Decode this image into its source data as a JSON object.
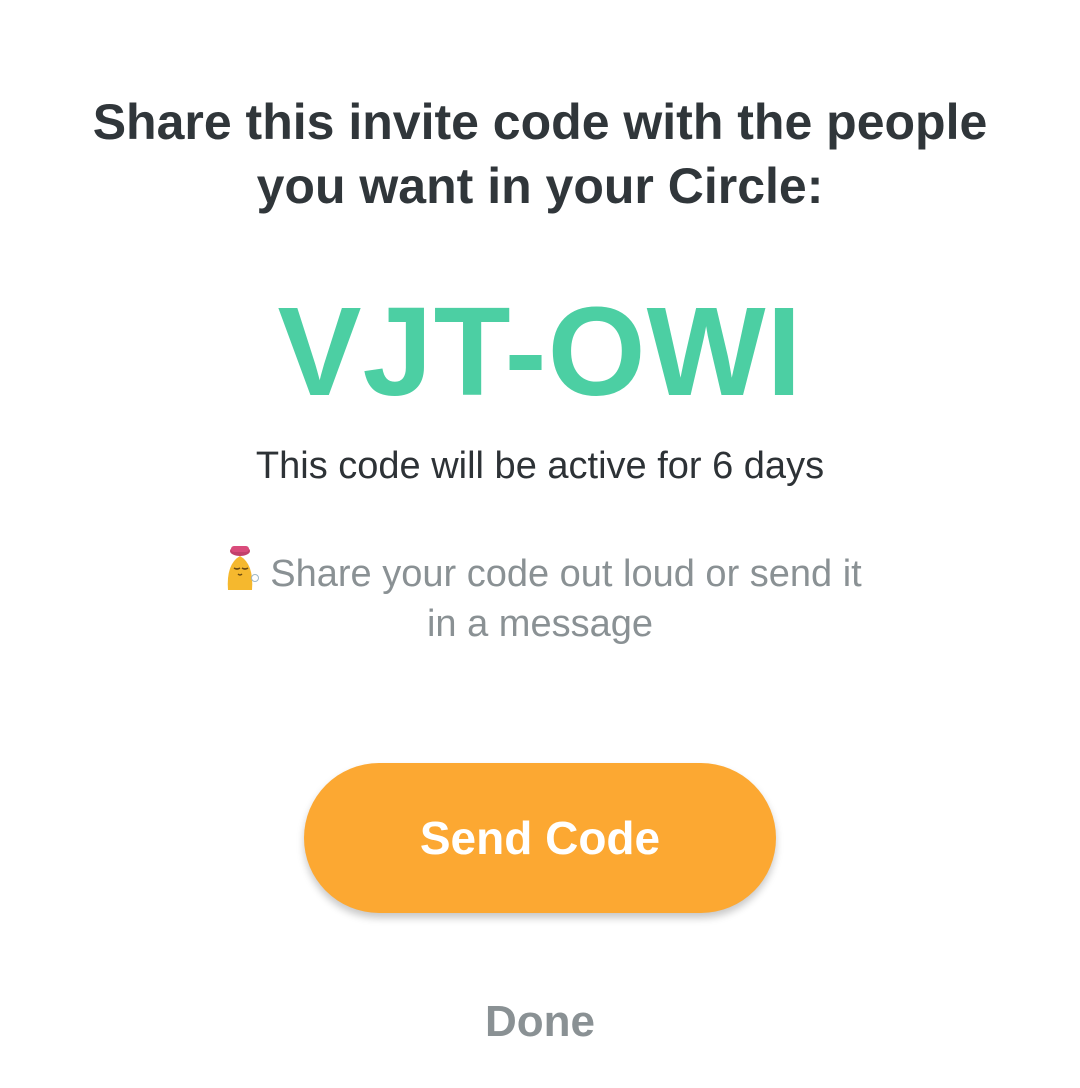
{
  "dialog": {
    "heading": "Share this invite code with the people you want in your Circle:",
    "invite_code": "VJT-OWI",
    "expiry_text": "This code will be active for 6 days",
    "hint": {
      "mascot_icon": "mascot-icon",
      "text": "Share your code out loud or send it in a message"
    },
    "send_button_label": "Send Code",
    "done_label": "Done"
  },
  "colors": {
    "code": "#4ccfa3",
    "button": "#fca832",
    "heading": "#30363a",
    "muted": "#8a9194"
  }
}
